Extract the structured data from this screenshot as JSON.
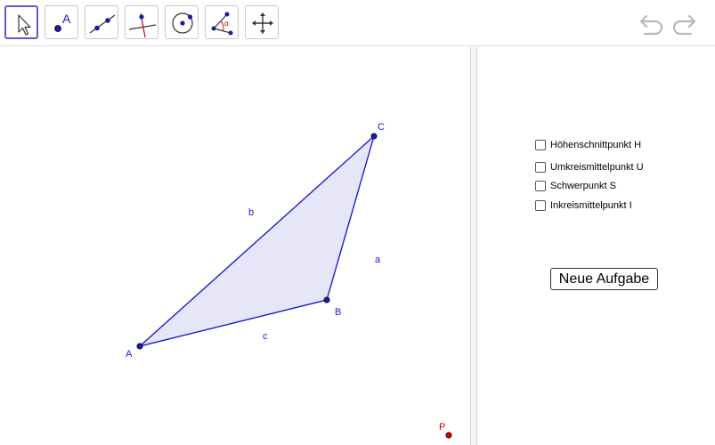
{
  "toolbar": {
    "tools": [
      {
        "icon": "pointer-arrow-icon",
        "active": true
      },
      {
        "icon": "point-icon",
        "label": "A"
      },
      {
        "icon": "line-through-two-points-icon"
      },
      {
        "icon": "perpendicular-line-icon"
      },
      {
        "icon": "circle-with-center-icon"
      },
      {
        "icon": "angle-icon",
        "label": "α"
      },
      {
        "icon": "move-graphics-view-icon"
      }
    ],
    "undo_icon": "undo-icon",
    "redo_icon": "redo-icon",
    "accent_color": "#6557d2"
  },
  "graphics": {
    "points": {
      "A": {
        "label": "A"
      },
      "B": {
        "label": "B"
      },
      "C": {
        "label": "C"
      },
      "P": {
        "label": "P"
      }
    },
    "sides": {
      "a": "a",
      "b": "b",
      "c": "c"
    },
    "colors": {
      "triangle_stroke": "#1a1ad0",
      "triangle_fill": "#e6e6f8",
      "point_fill": "#1a1aa6",
      "point_p": "#cc0000"
    }
  },
  "panel": {
    "checkboxes": [
      {
        "label": "Höhenschnittpunkt H",
        "checked": false
      },
      {
        "label": "Umkreismittelpunkt U",
        "checked": false
      },
      {
        "label": "Schwerpunkt S",
        "checked": false
      },
      {
        "label": "Inkreismittelpunkt I",
        "checked": false
      }
    ],
    "button_label": "Neue Aufgabe"
  }
}
